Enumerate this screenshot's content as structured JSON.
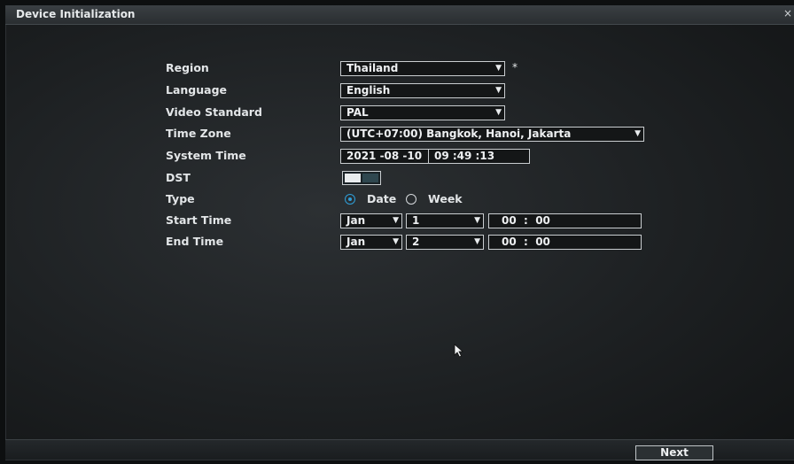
{
  "window": {
    "title": "Device Initialization"
  },
  "form": {
    "region": {
      "label": "Region",
      "value": "Thailand",
      "required_mark": "*"
    },
    "language": {
      "label": "Language",
      "value": "English"
    },
    "video_standard": {
      "label": "Video Standard",
      "value": "PAL"
    },
    "time_zone": {
      "label": "Time Zone",
      "value": "(UTC+07:00) Bangkok, Hanoi, Jakarta"
    },
    "system_time": {
      "label": "System Time",
      "date": "2021 -08 -10",
      "time": "09 :49 :13"
    },
    "dst": {
      "label": "DST",
      "enabled": true
    },
    "type": {
      "label": "Type",
      "options": [
        "Date",
        "Week"
      ],
      "selected": "Date"
    },
    "start_time": {
      "label": "Start Time",
      "month": "Jan",
      "day": "1",
      "time": "00  :  00"
    },
    "end_time": {
      "label": "End Time",
      "month": "Jan",
      "day": "2",
      "time": "00  :  00"
    }
  },
  "footer": {
    "next_label": "Next"
  },
  "icons": {
    "dropdown": "chevron-down-icon",
    "cursor": "mouse-pointer-icon"
  },
  "colors": {
    "accent": "#2e9ed8",
    "background": "#1d2022",
    "border": "#c9cdd0"
  }
}
